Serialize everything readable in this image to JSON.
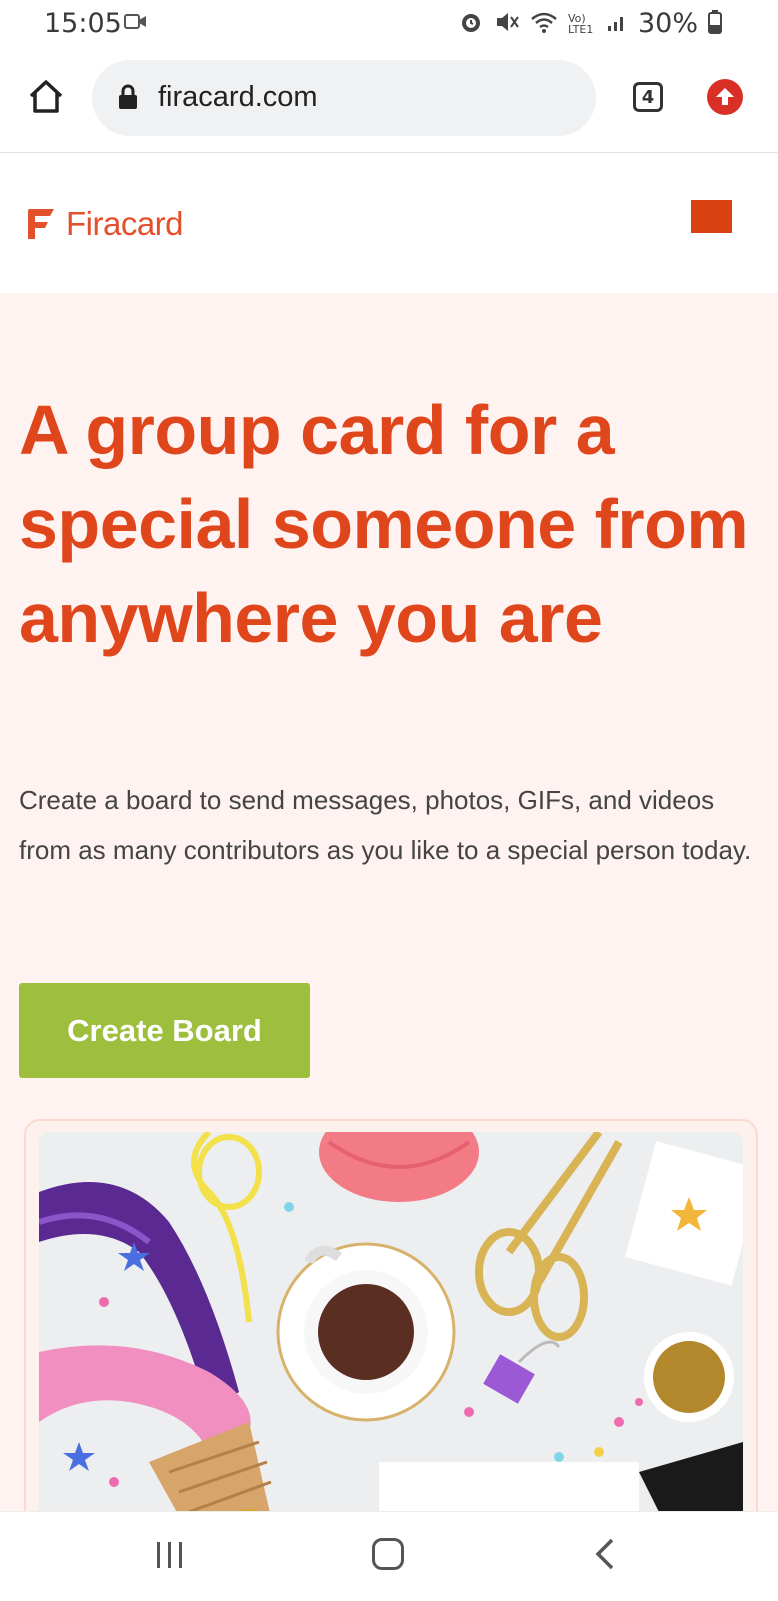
{
  "status_bar": {
    "time": "15:05",
    "battery": "30%",
    "network_label": "Vo) LTE1"
  },
  "browser": {
    "url": "firacard.com",
    "tab_count": "4"
  },
  "site": {
    "logo_text": "Firacard",
    "brand_color": "#e2502c"
  },
  "hero": {
    "headline": "A group card for a special someone from anywhere you are",
    "description": "Create a board to send messages, photos, GIFs, and videos from as many contributors as you like to a special person today.",
    "cta_label": "Create Board",
    "cta_color": "#9ebf3e",
    "background": "#fef3f1"
  },
  "colors": {
    "headline": "#e0461c",
    "menu_button": "#d94314"
  },
  "icons": [
    "home-icon",
    "lock-icon",
    "tabs-icon",
    "update-icon",
    "recent-apps-icon",
    "home-nav-icon",
    "back-icon"
  ]
}
